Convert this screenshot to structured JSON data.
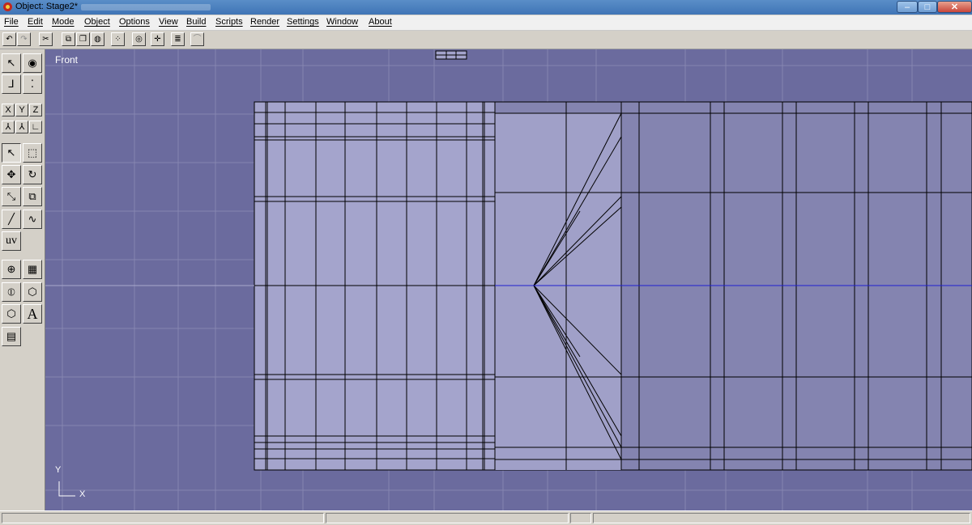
{
  "window": {
    "title": "Object: Stage2*"
  },
  "menu": [
    "File",
    "Edit",
    "Mode",
    "Object",
    "Options",
    "View",
    "Build",
    "Scripts",
    "Render",
    "Settings",
    "Window",
    "About"
  ],
  "viewport": {
    "label": "Front",
    "axis_y": "Y",
    "axis_x": "X"
  },
  "sidebar": {
    "x_label": "X",
    "y_label": "Y",
    "z_label": "Z",
    "uv_label": "uv",
    "text_label": "A"
  },
  "window_controls": {
    "close_label": "✕"
  },
  "colors": {
    "viewport_bg": "#6b6b9e",
    "highlight_axis": "#1a1acc",
    "mesh_fill": "#a8a8cc",
    "wire": "#000000"
  }
}
